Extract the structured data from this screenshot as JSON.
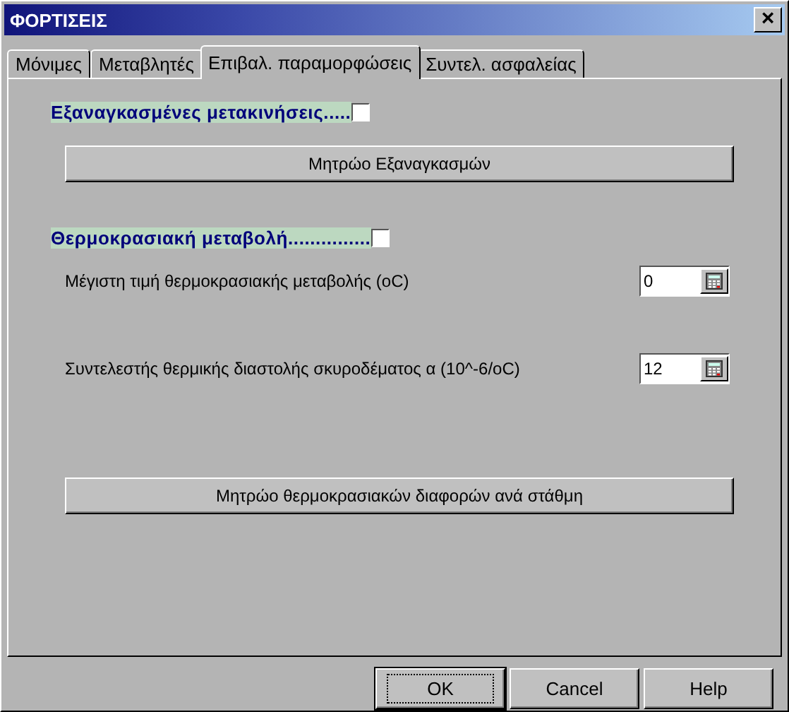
{
  "window": {
    "title": "ΦΟΡΤΙΣΕΙΣ",
    "close": "×"
  },
  "tabs": [
    {
      "label": "Μόνιμες",
      "selected": false
    },
    {
      "label": "Μεταβλητές",
      "selected": false
    },
    {
      "label": "Επιβαλ. παραμορφώσεις",
      "selected": true
    },
    {
      "label": "Συντελ. ασφαλείας",
      "selected": false
    }
  ],
  "imposed": {
    "label": "Εξαναγκασμένες μετακινήσεις.....",
    "checked": false,
    "button": "Μητρώο Εξαναγκασμών"
  },
  "thermal": {
    "label": "Θερμοκρασιακή μεταβολή...............",
    "checked": false,
    "fields": [
      {
        "label": "Μέγιστη τιμή θερμοκρασιακής μεταβολής  (oC)",
        "value": "0"
      },
      {
        "label": "Συντελεστής θερμικής διαστολής σκυροδέματος α (10^-6/oC)",
        "value": "12"
      }
    ],
    "button": "Μητρώο θερμοκρασιακών διαφορών ανά στάθμη"
  },
  "buttons": [
    {
      "label": "OK",
      "kind": "default"
    },
    {
      "label": "Cancel",
      "kind": "normal"
    },
    {
      "label": "Help",
      "kind": "normal"
    }
  ]
}
